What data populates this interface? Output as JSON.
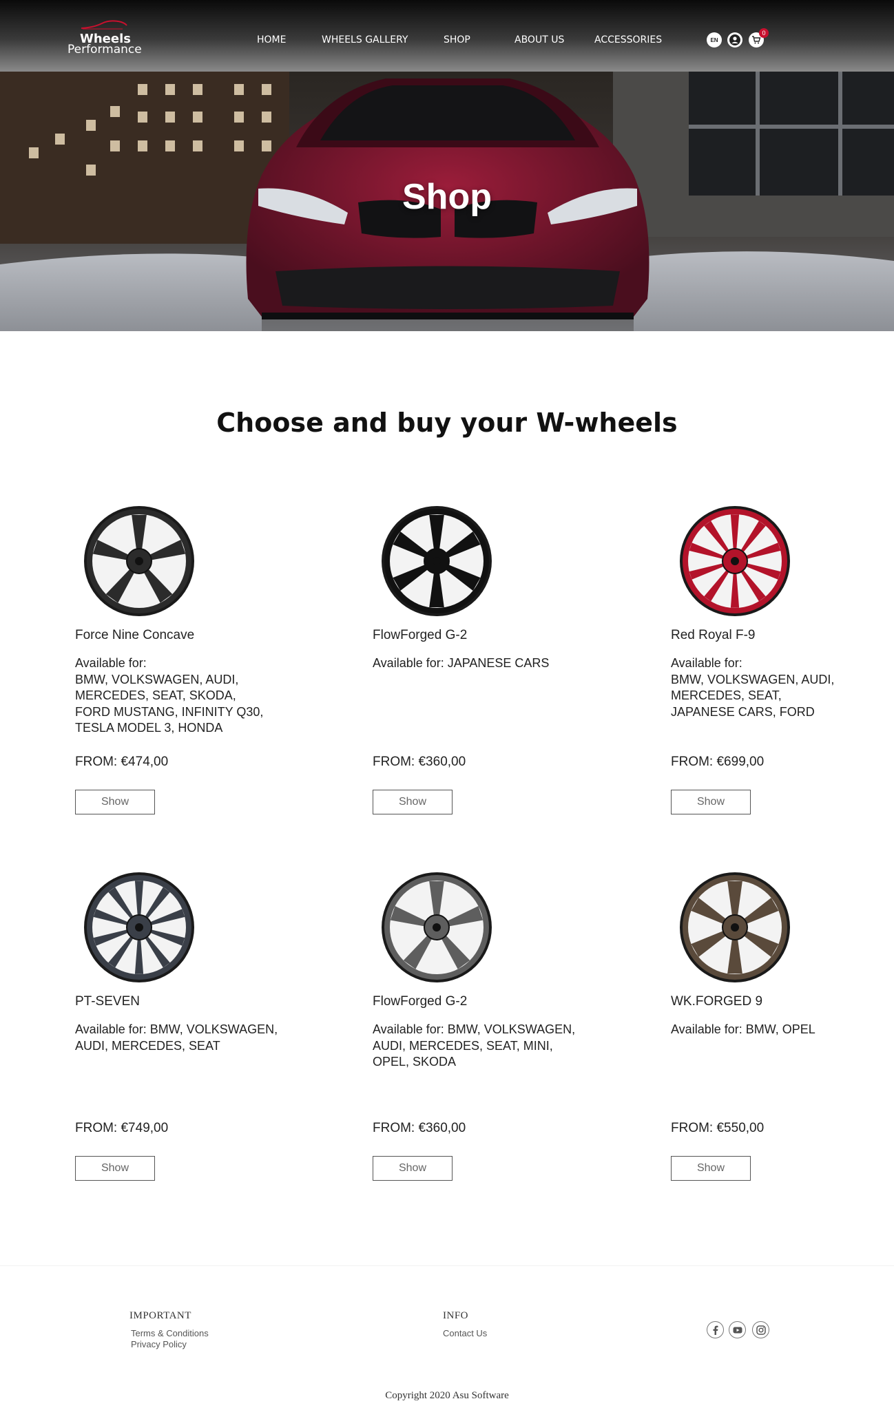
{
  "header": {
    "logo_line1": "Wheels",
    "logo_line2": "Performance",
    "nav": [
      "HOME",
      "WHEELS GALLERY",
      "SHOP",
      "ABOUT US",
      "ACCESSORIES"
    ],
    "language": "EN",
    "cart_count": "0",
    "icons": [
      "language-icon",
      "account-icon",
      "cart-icon"
    ]
  },
  "hero": {
    "title": "Shop"
  },
  "section_title": "Choose and buy your W-wheels",
  "products": [
    {
      "name": "Force Nine Concave",
      "available": "Available for:\nBMW, VOLKSWAGEN, AUDI,\nMERCEDES, SEAT, SKODA,\nFORD MUSTANG, INFINITY Q30,\nTESLA MODEL 3, HONDA",
      "price": "FROM: €474,00",
      "button": "Show",
      "wheel_color": "#2b2b2b"
    },
    {
      "name": "FlowForged G-2",
      "available": "Available for: JAPANESE CARS",
      "price": "FROM: €360,00",
      "button": "Show",
      "wheel_color": "#111111"
    },
    {
      "name": "Red Royal F-9",
      "available": "Available for:\nBMW, VOLKSWAGEN, AUDI,\nMERCEDES, SEAT,\nJAPANESE CARS, FORD",
      "price": "FROM: €699,00",
      "button": "Show",
      "wheel_color": "#b3132a"
    },
    {
      "name": "PT-SEVEN",
      "available": "Available for: BMW, VOLKSWAGEN,\nAUDI, MERCEDES, SEAT",
      "price": "FROM: €749,00",
      "button": "Show",
      "wheel_color": "#3a3f48"
    },
    {
      "name": "FlowForged G-2",
      "available": "Available for: BMW, VOLKSWAGEN,\nAUDI, MERCEDES, SEAT, MINI,\nOPEL, SKODA",
      "price": "FROM: €360,00",
      "button": "Show",
      "wheel_color": "#5e5e5e"
    },
    {
      "name": "WK.FORGED 9",
      "available": "Available for: BMW, OPEL",
      "price": "FROM: €550,00",
      "button": "Show",
      "wheel_color": "#5a4a3b"
    }
  ],
  "footer": {
    "important_heading": "IMPORTANT",
    "important_links": [
      "Terms & Conditions",
      "Privacy Policy"
    ],
    "info_heading": "INFO",
    "info_links": [
      "Contact Us"
    ],
    "social": [
      "facebook-icon",
      "youtube-icon",
      "instagram-icon"
    ],
    "copyright": "Copyright 2020 Asu Software"
  }
}
